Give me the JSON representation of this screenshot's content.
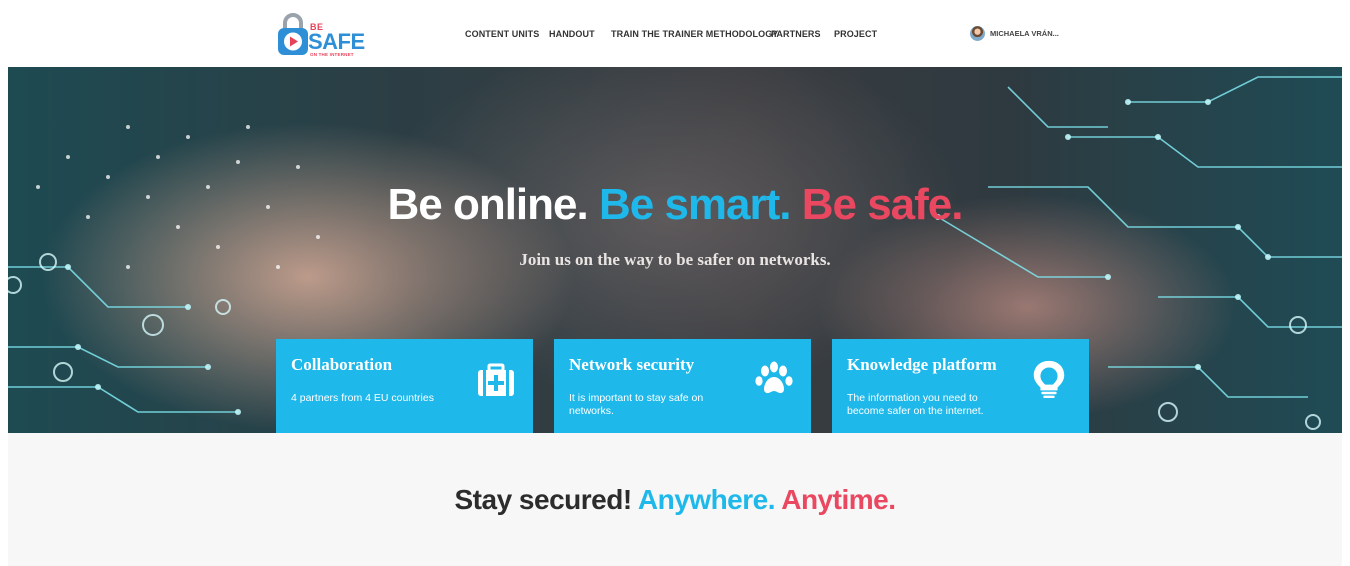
{
  "header": {
    "logo": {
      "be": "BE",
      "safe": "SAFE",
      "tagline": "ON THE INTERNET"
    },
    "nav": [
      {
        "label": "CONTENT UNITS"
      },
      {
        "label": "HANDOUT"
      },
      {
        "label": "TRAIN THE TRAINER METHODOLOGY"
      },
      {
        "label": "PARTNERS"
      },
      {
        "label": "PROJECT"
      }
    ],
    "user": {
      "name": "MICHAELA VRÁN..."
    }
  },
  "hero": {
    "title": {
      "part1": "Be online. ",
      "part2": "Be smart. ",
      "part3": "Be safe."
    },
    "subtitle": "Join us on the way to be safer on networks."
  },
  "cards": [
    {
      "title": "Collaboration",
      "desc": "4 partners from 4 EU countries",
      "icon": "first-aid-kit-icon"
    },
    {
      "title": "Network security",
      "desc": "It is important to stay safe on networks.",
      "icon": "paw-icon"
    },
    {
      "title": "Knowledge platform",
      "desc": "The information you need to become safer on the internet.",
      "icon": "lightbulb-icon"
    }
  ],
  "section": {
    "tagline": {
      "part1": "Stay secured! ",
      "part2": "Anywhere. ",
      "part3": "Anytime."
    }
  },
  "colors": {
    "accent_blue": "#1fb8ea",
    "accent_red": "#ea4760",
    "logo_blue": "#2f8fd6"
  }
}
